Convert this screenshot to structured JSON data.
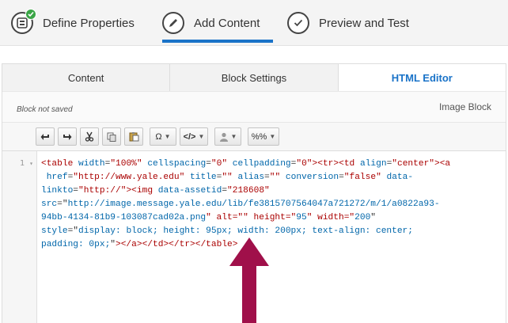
{
  "wizard": {
    "steps": [
      {
        "label": "Define Properties",
        "state": "complete"
      },
      {
        "label": "Add Content",
        "state": "active"
      },
      {
        "label": "Preview and Test",
        "state": "pending"
      }
    ],
    "accent_color": "#1a73c8",
    "complete_color": "#3aa546"
  },
  "tabs": [
    {
      "label": "Content"
    },
    {
      "label": "Block Settings"
    },
    {
      "label": "HTML Editor",
      "active": true
    }
  ],
  "block": {
    "status": "Block not saved",
    "type": "Image Block"
  },
  "toolbar": {
    "buttons": [
      {
        "name": "undo-icon"
      },
      {
        "name": "redo-icon"
      },
      {
        "name": "cut-icon"
      },
      {
        "name": "copy-icon"
      },
      {
        "name": "paste-icon"
      },
      {
        "name": "omega-icon",
        "label": "Ω"
      },
      {
        "name": "code-icon",
        "label": "</>"
      },
      {
        "name": "person-icon"
      },
      {
        "name": "percent-icon",
        "label": "%%"
      }
    ]
  },
  "editor": {
    "line_number": "1",
    "fold_marker": "▾",
    "lines": [
      "<table width=\"100%\" cellspacing=\"0\" cellpadding=\"0\"><tr><td align=\"center\"><a",
      " href=\"http://www.yale.edu\" title=\"\" alias=\"\" conversion=\"false\" data-",
      "linkto=\"http://\"><img data-assetid=\"218608\"",
      "src=\"http://image.message.yale.edu/lib/fe3815707564047a721272/m/1/a0822a93-",
      "94bb-4134-81b9-103087cad02a.png\" alt=\"\" height=\"95\" width=\"200\"",
      "style=\"display: block; height: 95px; width: 200px; text-align: center;",
      "padding: 0px;\"></a></td></tr></table>"
    ]
  },
  "annotation": {
    "arrow_color": "#a0104a",
    "points_to": "alt=\"\""
  }
}
